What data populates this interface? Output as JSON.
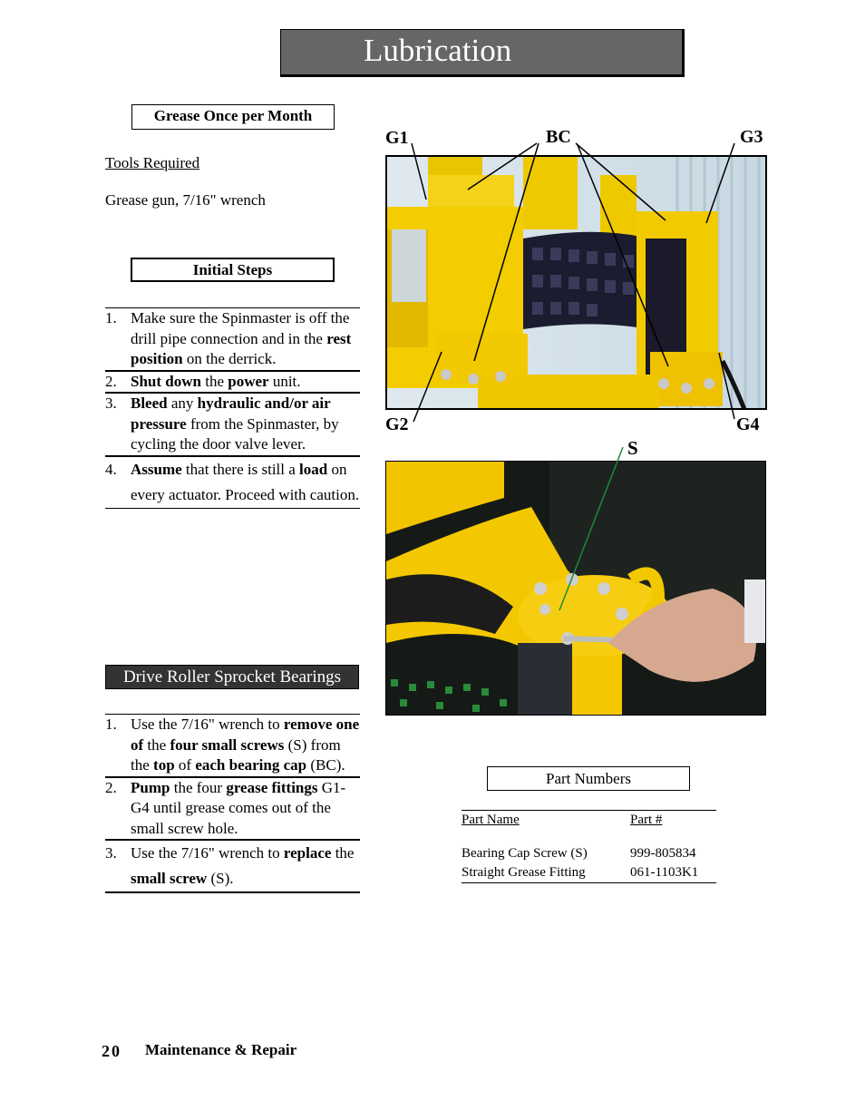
{
  "page": {
    "title": "Lubrication",
    "footer": {
      "page_number": "20",
      "section": "Maintenance & Repair"
    }
  },
  "grease_schedule": {
    "label": "Grease Once per Month"
  },
  "tools": {
    "label": "Tools Required",
    "value": "Grease gun, 7/16\" wrench"
  },
  "initial_steps": {
    "heading": "Initial Steps",
    "steps": [
      {
        "num": "1.",
        "html": "Make sure the Spinmaster is off the drill pipe connection and in the <b>rest position</b> on the derrick."
      },
      {
        "num": "2.",
        "html": "<b>Shut down</b> the <b>power</b> unit."
      },
      {
        "num": "3.",
        "html": "<b>Bleed</b> any <b>hydraulic and/or air pressure</b> from the Spinmaster, by cycling the door valve lever."
      },
      {
        "num": "4.",
        "html": "<b>Assume</b> that there is still a <b>load</b> on every actuator.  Proceed with caution."
      }
    ]
  },
  "drive_roller": {
    "heading": "Drive Roller Sprocket Bearings",
    "steps": [
      {
        "num": "1.",
        "html": "Use the 7/16\" wrench to <b>remove one of</b> the <b>four small screws</b> (S) from the <b>top</b> of <b>each bearing cap</b> (BC)."
      },
      {
        "num": "2.",
        "html": "<b>Pump</b> the four <b>grease fittings</b> G1-G4 until grease comes out of the small screw hole."
      },
      {
        "num": "3.",
        "html": "Use the 7/16\" wrench to <b>replace</b> the <b>small screw</b> (S)."
      }
    ]
  },
  "photo_top": {
    "callouts": {
      "g1": "G1",
      "bc": "BC",
      "g3": "G3",
      "g2": "G2",
      "g4": "G4"
    }
  },
  "photo_bottom": {
    "callouts": {
      "s": "S"
    }
  },
  "part_numbers": {
    "heading": "Part Numbers",
    "columns": [
      "Part Name",
      "Part #"
    ],
    "rows": [
      [
        "Bearing Cap Screw (S)",
        "999-805834"
      ],
      [
        "Straight Grease Fitting",
        "061-1103K1"
      ]
    ]
  },
  "colors": {
    "title_bar": "#666666",
    "drive_heading_bg": "#333333",
    "machine_yellow": "#f2c500",
    "callout_line_s": "#1a8a3a"
  }
}
